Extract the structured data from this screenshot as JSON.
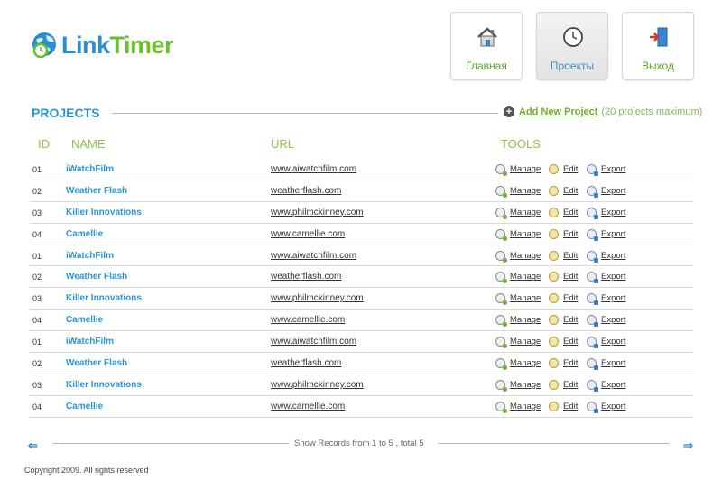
{
  "brand": {
    "part1": "Link",
    "part2": "Timer"
  },
  "nav": [
    {
      "label": "Главная",
      "icon": "home-icon"
    },
    {
      "label": "Проекты",
      "icon": "clock-icon"
    },
    {
      "label": "Выход",
      "icon": "exit-door-icon"
    }
  ],
  "section": {
    "title": "PROJECTS",
    "add_label": "Add New Project",
    "add_note": "(20 projects maximum)"
  },
  "columns": {
    "id": "ID",
    "name": "NAME",
    "url": "URL",
    "tools": "TOOLS"
  },
  "tools": {
    "manage": "Manage",
    "edit": "Edit",
    "export": "Export"
  },
  "rows": [
    {
      "id": "01",
      "name": "iWatchFilm",
      "url": "www.aiwatchfilm.com"
    },
    {
      "id": "02",
      "name": "Weather Flash",
      "url": "weatherflash.com"
    },
    {
      "id": "03",
      "name": "Killer Innovations",
      "url": "www.philmckinney.com"
    },
    {
      "id": "04",
      "name": "Camellie",
      "url": "www.camellie.com"
    },
    {
      "id": "01",
      "name": "iWatchFilm",
      "url": "www.aiwatchfilm.com"
    },
    {
      "id": "02",
      "name": "Weather Flash",
      "url": "weatherflash.com"
    },
    {
      "id": "03",
      "name": "Killer Innovations",
      "url": "www.philmckinney.com"
    },
    {
      "id": "04",
      "name": "Camellie",
      "url": "www.camellie.com"
    },
    {
      "id": "01",
      "name": "iWatchFilm",
      "url": "www.aiwatchfilm.com"
    },
    {
      "id": "02",
      "name": "Weather Flash",
      "url": "weatherflash.com"
    },
    {
      "id": "03",
      "name": "Killer Innovations",
      "url": "www.philmckinney.com"
    },
    {
      "id": "04",
      "name": "Camellie",
      "url": "www.camellie.com"
    }
  ],
  "pager": {
    "text": "Show Records from 1 to 5 , total 5"
  },
  "footer": {
    "copyright": "Copyright 2009. All rights reserved"
  },
  "colors": {
    "blue": "#2a95d5",
    "green": "#6bbf2e"
  }
}
